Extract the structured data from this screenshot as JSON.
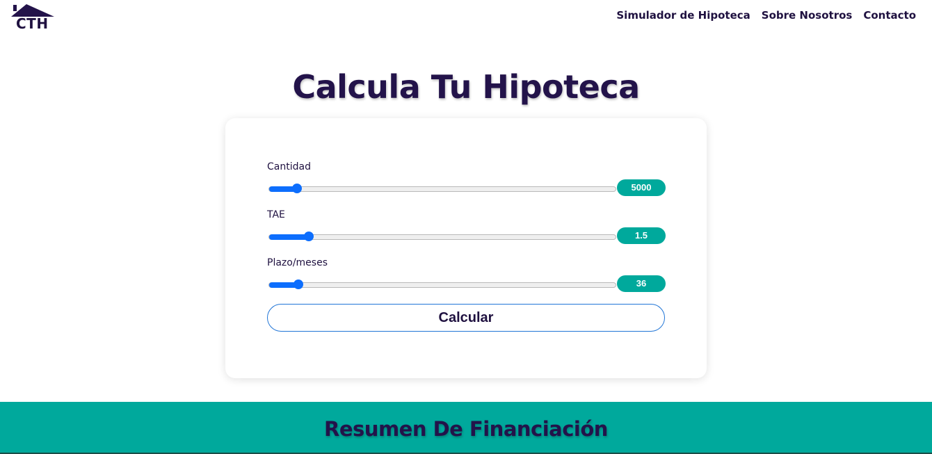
{
  "brand": {
    "logo_text": "CTH",
    "color": "#23134a"
  },
  "nav": {
    "items": [
      "Simulador de Hipoteca",
      "Sobre Nosotros",
      "Contacto"
    ]
  },
  "page": {
    "title": "Calcula Tu Hipoteca"
  },
  "form": {
    "fields": [
      {
        "label": "Cantidad",
        "value": "5000",
        "slider_fraction": 0.07
      },
      {
        "label": "TAE",
        "value": "1.5",
        "slider_fraction": 0.105
      },
      {
        "label": "Plazo/meses",
        "value": "36",
        "slider_fraction": 0.075
      }
    ],
    "submit_label": "Calcular"
  },
  "summary": {
    "title": "Resumen De Financiación",
    "background_color": "#00a99c"
  },
  "colors": {
    "accent": "#00a99c",
    "slider": "#0d6efd",
    "text": "#1f1140"
  },
  "icons": {
    "logo": "house-roof-icon"
  }
}
